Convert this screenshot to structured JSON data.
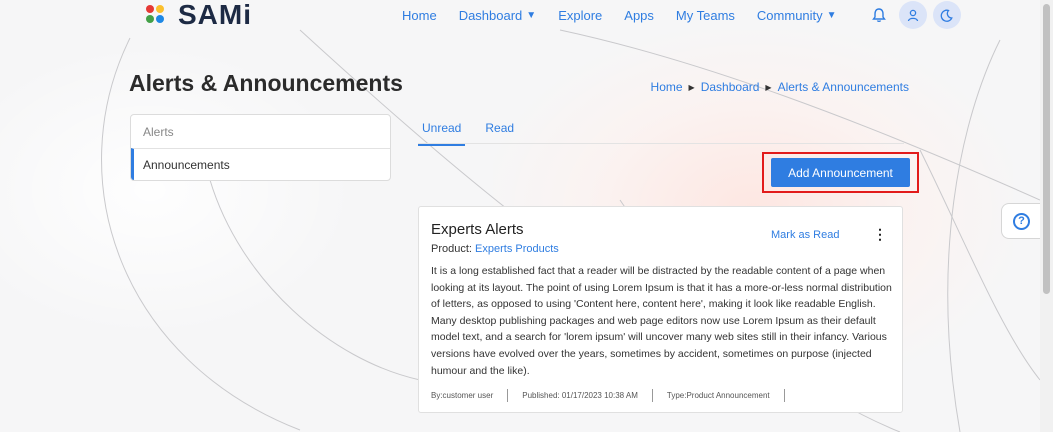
{
  "app": {
    "logo_text": "SAMi"
  },
  "nav": {
    "items": [
      "Home",
      "Dashboard",
      "Explore",
      "Apps",
      "My Teams",
      "Community"
    ],
    "icons": [
      "bell-icon",
      "user-icon",
      "moon-icon"
    ]
  },
  "page": {
    "title": "Alerts & Announcements"
  },
  "breadcrumb": {
    "items": [
      "Home",
      "Dashboard",
      "Alerts & Announcements"
    ]
  },
  "sidebar": {
    "items": [
      "Alerts",
      "Announcements"
    ],
    "active": "Announcements"
  },
  "tabs": {
    "items": [
      "Unread",
      "Read"
    ],
    "active": "Unread"
  },
  "actions": {
    "add_label": "Add Announcement"
  },
  "card": {
    "title": "Experts Alerts",
    "product_label": "Product: ",
    "product_value": "Experts Products",
    "mark_read": "Mark as Read",
    "menu_glyph": "⋮",
    "body": "It is a long established fact that a reader will be distracted by the readable content of a page when looking at its layout. The point of using Lorem Ipsum is that it has a more-or-less normal distribution of letters, as opposed to using 'Content here, content here', making it look like readable English. Many desktop publishing packages and web page editors now use Lorem Ipsum as their default model text, and a search for 'lorem ipsum' will uncover many web sites still in their infancy. Various versions have evolved over the years, sometimes by accident, sometimes on purpose (injected humour and the like).",
    "meta": {
      "by": "By:customer user",
      "published": "Published: 01/17/2023 10:38 AM",
      "type": "Type:Product Announcement"
    }
  },
  "help": {
    "glyph": "?"
  },
  "colors": {
    "accent": "#2f7de1",
    "highlight": "#e21b1b"
  }
}
